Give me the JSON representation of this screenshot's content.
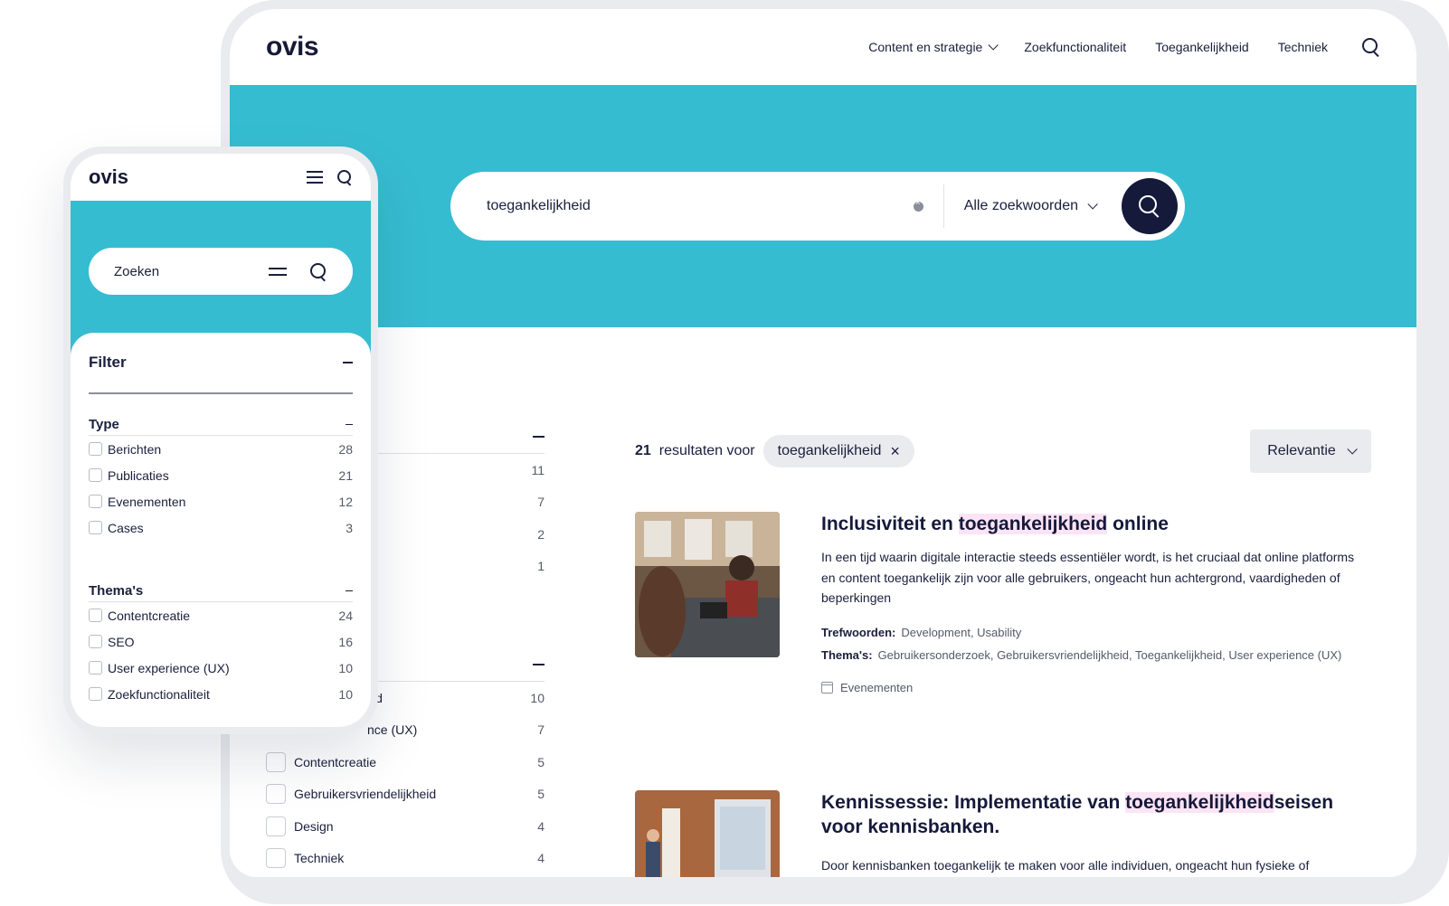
{
  "colors": {
    "accent": "#36bcd1",
    "navy": "#15193a",
    "highlight": "#fde4f4",
    "chip": "#e9ebef"
  },
  "desktop": {
    "logo": "ovis",
    "nav": [
      {
        "label": "Content en strategie",
        "has_dropdown": true
      },
      {
        "label": "Zoekfunctionaliteit"
      },
      {
        "label": "Toegankelijkheid"
      },
      {
        "label": "Techniek"
      }
    ],
    "search": {
      "value": "toegankelijkheid",
      "mode": "Alle zoekwoorden"
    },
    "filter_col": {
      "group1_counts": [
        "11",
        "7",
        "2",
        "1"
      ],
      "group2_rows": [
        {
          "label": "id",
          "count": "10"
        },
        {
          "label": "nce (UX)",
          "count": "7"
        },
        {
          "label": "Contentcreatie",
          "count": "5"
        },
        {
          "label": "Gebruikersvriendelijkheid",
          "count": "5"
        },
        {
          "label": "Design",
          "count": "4"
        },
        {
          "label": "Techniek",
          "count": "4"
        }
      ]
    },
    "results_bar": {
      "count": "21",
      "count_suffix": "resultaten voor",
      "query_chip": "toegankelijkheid",
      "sort": "Relevantie"
    },
    "results": [
      {
        "title_pre": "Inclusiviteit en ",
        "title_hl": "toegankelijkheid",
        "title_post": " online",
        "desc": "In een tijd waarin digitale interactie steeds essentiëler wordt, is het cruciaal dat online platforms en content toegankelijk zijn voor alle gebruikers, ongeacht hun achtergrond, vaardigheden of beperkingen",
        "keywords_label": "Trefwoorden:",
        "keywords": "Development, Usability",
        "themes_label": "Thema's:",
        "themes": "Gebruikersonderzoek, Gebruikersvriendelijkheid, Toegankelijkheid, User experience (UX)",
        "type": "Evenementen"
      },
      {
        "title_pre": "Kennissessie: Implementatie van ",
        "title_hl": "toegankelijkheid",
        "title_post": "seisen voor kennisbanken.",
        "desc": "Door kennisbanken toegankelijk te maken voor alle individuen, ongeacht hun fysieke of"
      }
    ]
  },
  "mobile": {
    "logo": "ovis",
    "search_placeholder": "Zoeken",
    "filter_title": "Filter",
    "groups": [
      {
        "title": "Type",
        "items": [
          {
            "label": "Berichten",
            "count": "28"
          },
          {
            "label": "Publicaties",
            "count": "21"
          },
          {
            "label": "Evenementen",
            "count": "12"
          },
          {
            "label": "Cases",
            "count": "3"
          }
        ]
      },
      {
        "title": "Thema's",
        "items": [
          {
            "label": "Contentcreatie",
            "count": "24"
          },
          {
            "label": "SEO",
            "count": "16"
          },
          {
            "label": "User experience (UX)",
            "count": "10"
          },
          {
            "label": "Zoekfunctionaliteit",
            "count": "10"
          }
        ]
      }
    ]
  }
}
